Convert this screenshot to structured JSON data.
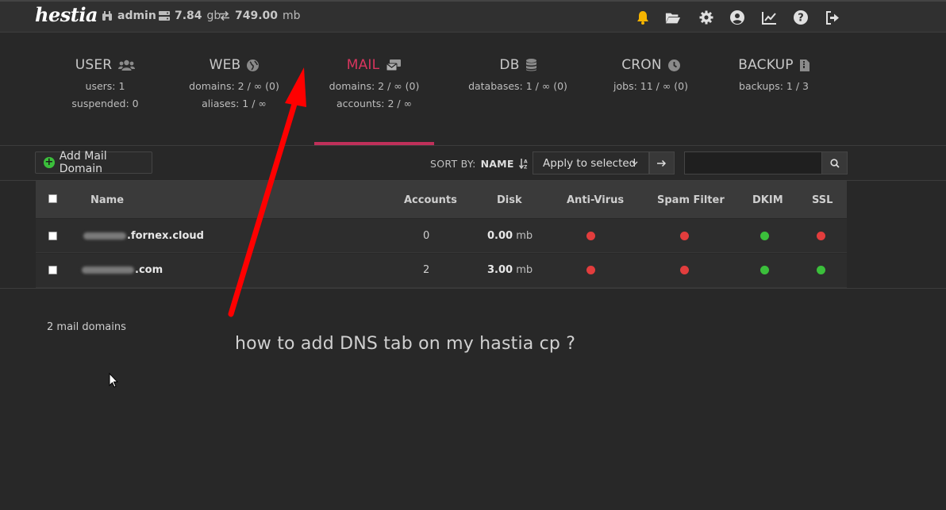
{
  "topbar": {
    "logo": "hestia",
    "user": "admin",
    "disk_value": "7.84",
    "disk_unit": "gb",
    "bandwidth_value": "749.00",
    "bandwidth_unit": "mb",
    "icons": [
      "bell-icon",
      "folder-open-icon",
      "gear-icon",
      "user-circle-icon",
      "chart-line-icon",
      "question-icon",
      "logout-icon"
    ],
    "bell_color": "#f5b400"
  },
  "tabs": [
    {
      "title": "USER",
      "icon": "users-icon",
      "lines": [
        "users: 1",
        "suspended: 0"
      ],
      "active": false
    },
    {
      "title": "WEB",
      "icon": "globe-icon",
      "lines": [
        "domains: 2 / ∞ (0)",
        "aliases: 1 / ∞"
      ],
      "active": false
    },
    {
      "title": "MAIL",
      "icon": "mail-bulk-icon",
      "lines": [
        "domains: 2 / ∞ (0)",
        "accounts: 2 / ∞"
      ],
      "active": true
    },
    {
      "title": "DB",
      "icon": "database-icon",
      "lines": [
        "databases: 1 / ∞ (0)"
      ],
      "active": false
    },
    {
      "title": "CRON",
      "icon": "clock-icon",
      "lines": [
        "jobs: 11 / ∞ (0)"
      ],
      "active": false
    },
    {
      "title": "BACKUP",
      "icon": "file-archive-icon",
      "lines": [
        "backups: 1 / 3"
      ],
      "active": false
    }
  ],
  "accent_color": "#d8355e",
  "toolbar": {
    "add_label": "Add Mail Domain",
    "sort_label": "SORT BY:",
    "sort_value": "NAME",
    "select_value": "Apply to selected",
    "search_placeholder": ""
  },
  "table": {
    "headers": [
      "Name",
      "Accounts",
      "Disk",
      "Anti-Virus",
      "Spam Filter",
      "DKIM",
      "SSL"
    ],
    "rows": [
      {
        "domain_visible": ".fornex.cloud",
        "accounts": "0",
        "disk_value": "0.00",
        "disk_unit": "mb",
        "antivirus": false,
        "spam": false,
        "dkim": true,
        "ssl": false
      },
      {
        "domain_visible": ".com",
        "accounts": "2",
        "disk_value": "3.00",
        "disk_unit": "mb",
        "antivirus": false,
        "spam": false,
        "dkim": true,
        "ssl": true
      }
    ]
  },
  "footer": {
    "count_text": "2 mail domains"
  },
  "annotation": {
    "question": "how to add DNS tab on my hastia cp  ?",
    "arrow_color": "#ff0000"
  }
}
